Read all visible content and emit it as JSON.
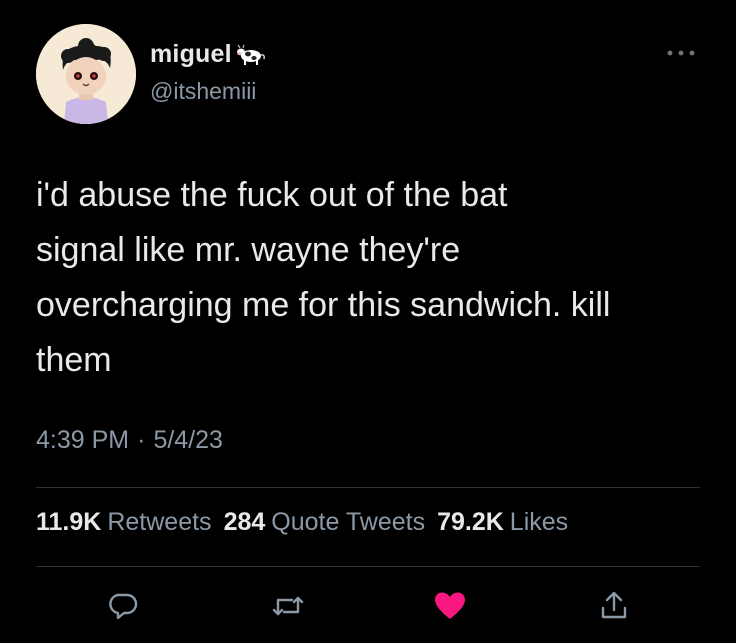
{
  "user": {
    "display_name": "miguel",
    "name_emoji_icon": "cow-icon",
    "handle": "@itshemiii",
    "avatar_icon": "avatar-illustration"
  },
  "tweet": {
    "text": "i'd abuse the fuck out of the bat\nsignal like mr. wayne they're\novercharging me for this sandwich. kill\nthem",
    "time": "4:39 PM",
    "separator": "·",
    "date": "5/4/23"
  },
  "stats": {
    "retweets_count": "11.9K",
    "retweets_label": "Retweets",
    "quotes_count": "284",
    "quotes_label": "Quote Tweets",
    "likes_count": "79.2K",
    "likes_label": "Likes"
  },
  "actions": [
    {
      "icon": "reply-icon"
    },
    {
      "icon": "retweet-icon"
    },
    {
      "icon": "like-icon-filled"
    },
    {
      "icon": "share-icon"
    }
  ],
  "colors": {
    "background": "#000000",
    "primary_text": "#e7e9ea",
    "secondary_text": "#8b98a5",
    "divider": "#2f3336",
    "like_pink": "#f91880"
  }
}
